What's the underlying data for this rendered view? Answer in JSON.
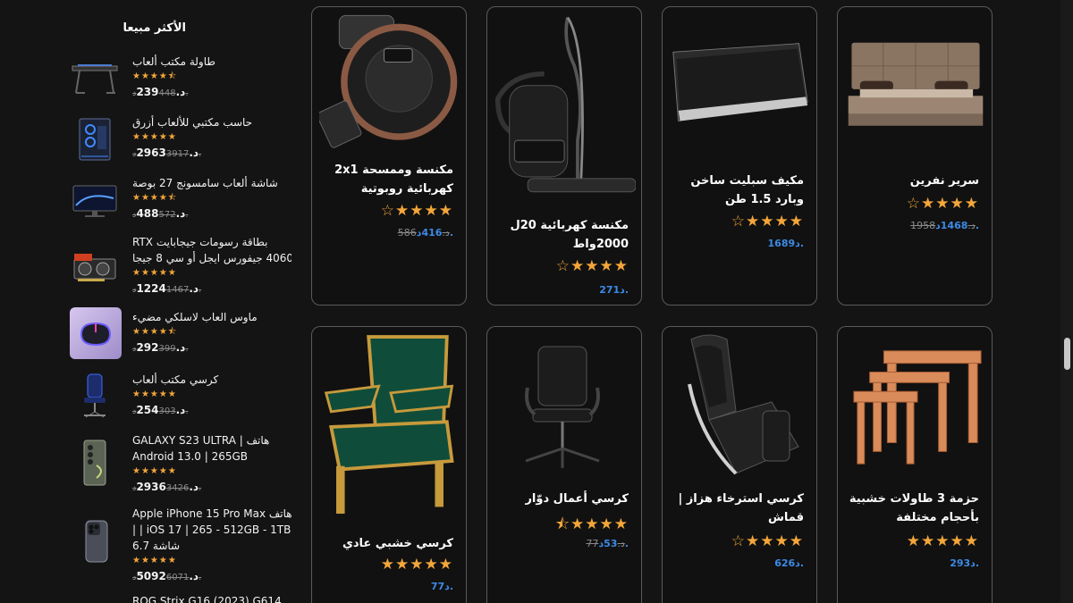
{
  "sidebar": {
    "title": "الأكثر مبيعا",
    "items": [
      {
        "name": "طاولة مكتب ألعاب",
        "stars": "★★★★⯪",
        "old_price": "448د.",
        "price": "د.239"
      },
      {
        "name": "حاسب مكتبي للألعاب أزرق",
        "stars": "★★★★★",
        "old_price": "3917د.",
        "price": "د.2963"
      },
      {
        "name": "شاشة ألعاب سامسونج 27 بوصة",
        "stars": "★★★★⯪",
        "old_price": "572د.",
        "price": "د.488"
      },
      {
        "name": "بطاقة رسومات جيجابايت RTX 4060 جيفورس ايجل أو سي 8 جيجا",
        "stars": "★★★★★",
        "old_price": "1467د.",
        "price": "د.1224"
      },
      {
        "name": "ماوس العاب لاسلكي مضيء",
        "stars": "★★★★⯪",
        "old_price": "399د.",
        "price": "د.292"
      },
      {
        "name": "كرسي مكتب ألعاب",
        "stars": "★★★★★",
        "old_price": "303د.",
        "price": "د.254"
      },
      {
        "name": "هاتف GALAXY S23 ULTRA | Android 13.0 | 265GB",
        "stars": "★★★★★",
        "old_price": "3426د.",
        "price": "د.2936"
      },
      {
        "name": "هاتف Apple iPhone 15 Pro Max | iOS 17 | 265 - 512GB - 1TB | شاشة 6.7",
        "stars": "★★★★★",
        "old_price": "6071د.",
        "price": "د.5092"
      },
      {
        "name": "ROG Strix G16 (2023) G614",
        "stars": "",
        "old_price": "",
        "price": ""
      }
    ]
  },
  "products": [
    {
      "title": "سرير نفرين",
      "stars": "☆★★★★",
      "old_price": "1958د.",
      "price": "1468د."
    },
    {
      "title": "مكيف سبليت ساخن وبارد 1.5 طن",
      "stars": "☆★★★★",
      "old_price": "",
      "price": "1689د."
    },
    {
      "title": "مكنسة كهربائية 20ل 2000واط",
      "stars": "☆★★★★",
      "old_price": "",
      "price": "271د."
    },
    {
      "title": "مكنسة وممسحة 2x1 كهربائية روبوتية",
      "stars": "☆★★★★",
      "old_price": "586د.",
      "price": "416د."
    },
    {
      "title": "حزمة 3 طاولات خشبية بأحجام مختلفة",
      "stars": "★★★★★",
      "old_price": "",
      "price": "293د."
    },
    {
      "title": "كرسي استرخاء هزاز | قماش",
      "stars": "☆★★★★",
      "old_price": "",
      "price": "626د."
    },
    {
      "title": "كرسي أعمال دوّار",
      "stars": "⯪★★★★",
      "old_price": "77د.",
      "price": "53د."
    },
    {
      "title": "كرسي خشبي عادي",
      "stars": "★★★★★",
      "old_price": "",
      "price": "77د."
    }
  ]
}
